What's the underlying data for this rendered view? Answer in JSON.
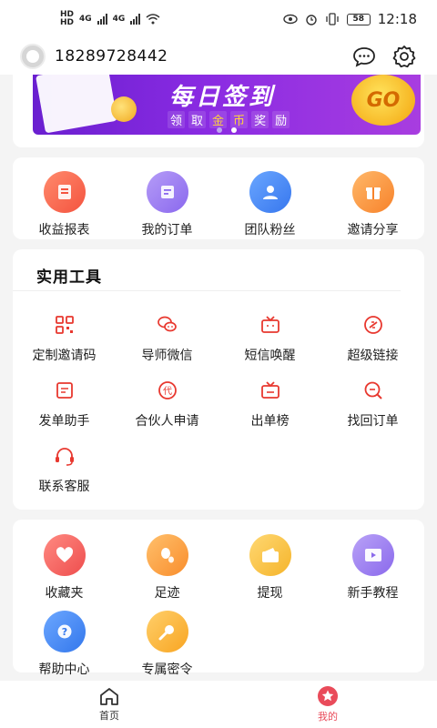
{
  "status_bar": {
    "left_hd1": "HD",
    "left_hd2": "HD",
    "net1": "4G",
    "net2": "4G",
    "battery": "58",
    "time": "12:18"
  },
  "header": {
    "phone": "18289728442",
    "icons": [
      "avatar-placeholder-icon",
      "message-icon",
      "settings-gear-icon"
    ]
  },
  "banner": {
    "title": "每日签到",
    "subtitle_chars": [
      "领",
      "取",
      "金",
      "币",
      "奖",
      "励"
    ],
    "go_label": "GO",
    "slide_count": 2,
    "active_slide": 2
  },
  "quick_menu": {
    "items": [
      {
        "label": "收益报表",
        "icon": "report-icon",
        "color": "#f96b57"
      },
      {
        "label": "我的订单",
        "icon": "order-icon",
        "color": "#9c7cf2"
      },
      {
        "label": "团队粉丝",
        "icon": "team-icon",
        "color": "#4c8ef5"
      },
      {
        "label": "邀请分享",
        "icon": "gift-icon",
        "color": "#fb9a3c"
      }
    ]
  },
  "tools": {
    "title": "实用工具",
    "items": [
      {
        "label": "定制邀请码",
        "icon": "qr-code-icon"
      },
      {
        "label": "导师微信",
        "icon": "wechat-icon"
      },
      {
        "label": "短信唤醒",
        "icon": "tv-message-icon"
      },
      {
        "label": "超级链接",
        "icon": "link-icon"
      },
      {
        "label": "发单助手",
        "icon": "document-icon"
      },
      {
        "label": "合伙人申请",
        "icon": "partner-badge-icon"
      },
      {
        "label": "出单榜",
        "icon": "ranking-tv-icon"
      },
      {
        "label": "找回订单",
        "icon": "search-order-icon"
      },
      {
        "label": "联系客服",
        "icon": "headset-icon"
      }
    ],
    "accent": "#e8382f"
  },
  "more_menu": {
    "items": [
      {
        "label": "收藏夹",
        "icon": "heart-icon",
        "color": "#f0625d"
      },
      {
        "label": "足迹",
        "icon": "footprint-icon",
        "color": "#fba441"
      },
      {
        "label": "提现",
        "icon": "wallet-icon",
        "color": "#f8c443"
      },
      {
        "label": "新手教程",
        "icon": "video-icon",
        "color": "#9b7cf0"
      },
      {
        "label": "帮助中心",
        "icon": "help-icon",
        "color": "#3f86f3"
      },
      {
        "label": "专属密令",
        "icon": "key-icon",
        "color": "#fbb437"
      }
    ]
  },
  "tabbar": {
    "items": [
      {
        "label": "首页",
        "icon": "home-icon",
        "active": false
      },
      {
        "label": "我的",
        "icon": "star-profile-icon",
        "active": true
      }
    ],
    "active_color": "#e94b5a",
    "inactive_color": "#333333"
  }
}
